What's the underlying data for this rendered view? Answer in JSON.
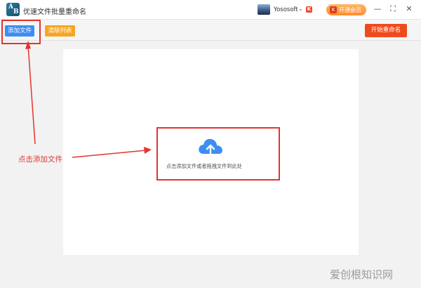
{
  "window": {
    "title": "优速文件批量重命名",
    "logo_letters": [
      "A",
      "B"
    ],
    "user": {
      "name": "Yososoft",
      "dropdown_icon": "chevron-down-icon",
      "badge_text": "K"
    },
    "vip": {
      "label": "开通会员",
      "icon_text": "K"
    },
    "controls": {
      "minimize": "—",
      "maximize": "⛶",
      "close": "✕"
    }
  },
  "toolbar": {
    "add_files_label": "添加文件",
    "clear_list_label": "清除列表",
    "start_rename_label": "开始重命名"
  },
  "drop_area": {
    "icon": "cloud-upload-icon",
    "hint": "点击添加文件或者拖拽文件到此处"
  },
  "annotation": {
    "label": "点击添加文件"
  },
  "watermark": "爱创根知识网",
  "colors": {
    "primary_blue": "#3d8ef2",
    "clear_orange": "#f5a623",
    "start_red": "#ef4a1c",
    "annotation_red": "#e3342f",
    "cloud_blue": "#3d8ef2"
  }
}
